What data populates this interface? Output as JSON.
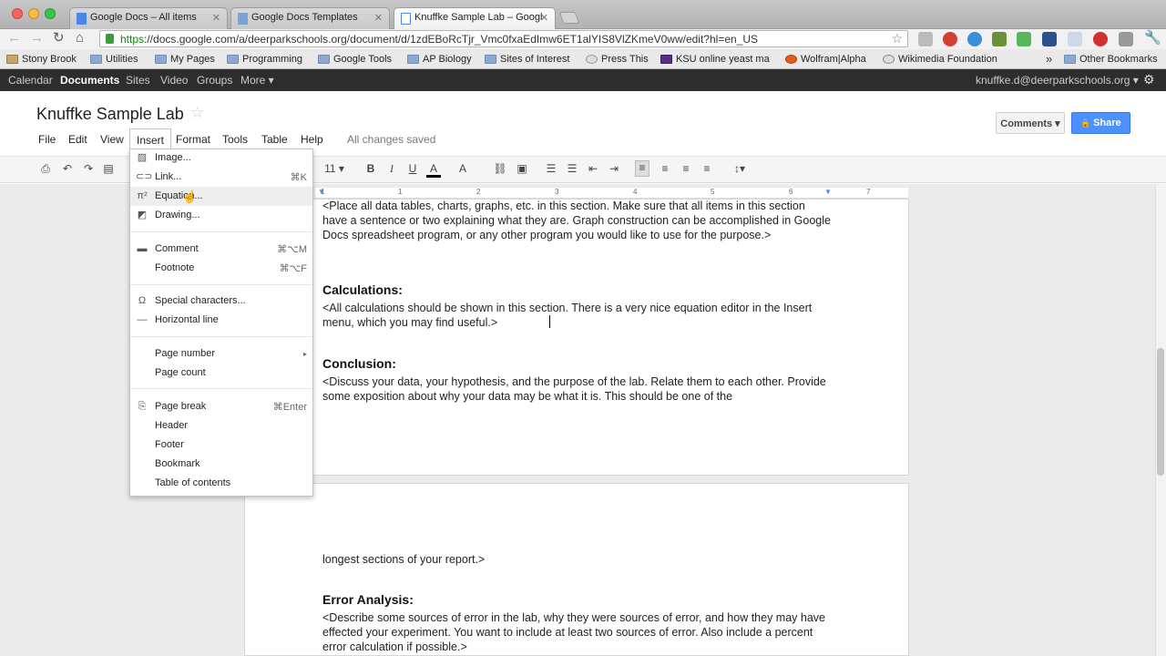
{
  "browser": {
    "tabs": [
      {
        "label": "Google Docs – All items"
      },
      {
        "label": "Google Docs Templates"
      },
      {
        "label": "Knuffke Sample Lab – Googl"
      }
    ],
    "url_scheme": "https",
    "url_rest": "://docs.google.com/a/deerparkschools.org/document/d/1zdEBoRcTjr_Vmc0fxaEdImw6ET1alYIS8VlZKmeV0ww/edit?hl=en_US",
    "bookmarks": [
      "Stony Brook",
      "Utilities",
      "My Pages",
      "Programming",
      "Google Tools",
      "AP Biology",
      "Sites of Interest",
      "Press This",
      "KSU online yeast ma",
      "Wolfram|Alpha",
      "Wikimedia Foundation"
    ],
    "bookmarks_more": "»",
    "other_bookmarks": "Other Bookmarks"
  },
  "google_bar": {
    "links": [
      "Calendar",
      "Documents",
      "Sites",
      "Video",
      "Groups",
      "More ▾"
    ],
    "account": "knuffke.d@deerparkschools.org ▾"
  },
  "doc": {
    "title": "Knuffke Sample Lab",
    "menus": [
      "File",
      "Edit",
      "View",
      "Insert",
      "Format",
      "Tools",
      "Table",
      "Help"
    ],
    "save_status": "All changes saved",
    "comments_label": "Comments ▾",
    "share_label": "Share",
    "font_size": "11"
  },
  "ruler_numbers": [
    "1",
    "1",
    "2",
    "3",
    "4",
    "5",
    "6",
    "7"
  ],
  "content": {
    "p1": "<Place all data tables, charts, graphs, etc. in this section.  Make sure that all items in this section have a sentence or two explaining what they are.  Graph construction can be accomplished in Google Docs spreadsheet program, or any other program you would like to use for the purpose.>",
    "h_calc": "Calculations:",
    "p_calc": "<All calculations should be shown in this section.  There is a very nice equation editor in the Insert menu, which you may find useful.>",
    "h_conc": "Conclusion:",
    "p_conc": "<Discuss your data, your hypothesis, and the purpose of the lab.  Relate them to each other. Provide some exposition about why your data may be what it is.  This should be one of the",
    "p_conc2": "longest sections of your report.>",
    "h_err": "Error Analysis:",
    "p_err": "<Describe some sources of error in the lab, why they were sources of error, and how they may have effected your experiment.  You want to include at least two sources of error.  Also include a percent error calculation if possible.>"
  },
  "insert_menu": {
    "items": [
      {
        "label": "Image...",
        "shortcut": ""
      },
      {
        "label": "Link...",
        "shortcut": "⌘K"
      },
      {
        "label": "Equation...",
        "shortcut": ""
      },
      {
        "label": "Drawing...",
        "shortcut": ""
      },
      {
        "label": "Comment",
        "shortcut": "⌘⌥M"
      },
      {
        "label": "Footnote",
        "shortcut": "⌘⌥F"
      },
      {
        "label": "Special characters...",
        "shortcut": ""
      },
      {
        "label": "Horizontal line",
        "shortcut": ""
      },
      {
        "label": "Page number",
        "shortcut": "▸"
      },
      {
        "label": "Page count",
        "shortcut": ""
      },
      {
        "label": "Page break",
        "shortcut": "⌘Enter"
      },
      {
        "label": "Header",
        "shortcut": ""
      },
      {
        "label": "Footer",
        "shortcut": ""
      },
      {
        "label": "Bookmark",
        "shortcut": ""
      },
      {
        "label": "Table of contents",
        "shortcut": ""
      }
    ]
  },
  "colors": {
    "share_blue": "#4d90fe",
    "google_bar": "#2d2d2d",
    "menu_highlight": "#eeeeee"
  }
}
